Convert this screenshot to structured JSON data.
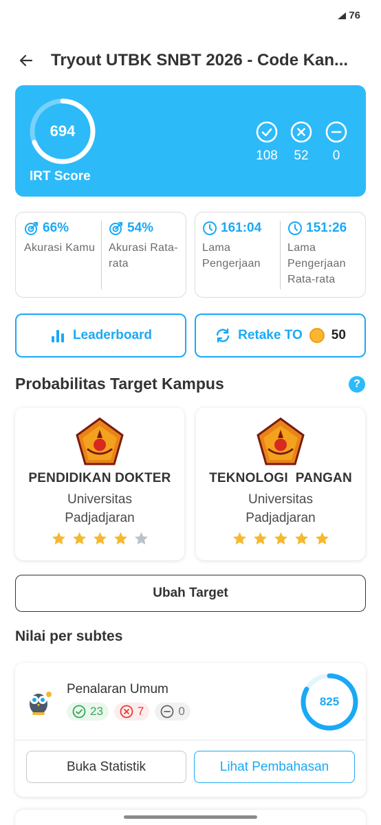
{
  "status": {
    "battery": "76"
  },
  "header": {
    "title": "Tryout UTBK SNBT 2026 - Code Kan..."
  },
  "score": {
    "value": "694",
    "label": "IRT Score",
    "progress": 0.69,
    "correct": "108",
    "wrong": "52",
    "empty": "0"
  },
  "metrics": {
    "accuracy_you": {
      "value": "66%",
      "label": "Akurasi Kamu"
    },
    "accuracy_avg": {
      "value": "54%",
      "label": "Akurasi Rata-rata"
    },
    "time_you": {
      "value": "161:04",
      "label": "Lama Pengerjaan"
    },
    "time_avg": {
      "value": "151:26",
      "label": "Lama Pengerjaan Rata-rata"
    }
  },
  "actions": {
    "leaderboard": "Leaderboard",
    "retake": "Retake TO",
    "retake_cost": "50"
  },
  "targets": {
    "title": "Probabilitas Target Kampus",
    "help": "?",
    "items": [
      {
        "major": "PENDIDIKAN DOKTER",
        "university": "Universitas Padjadjaran",
        "rating": 4,
        "max_rating": 5
      },
      {
        "major": "TEKNOLOGI  PANGAN",
        "university": "Universitas Padjadjaran",
        "rating": 5,
        "max_rating": 5
      }
    ],
    "change_button": "Ubah Target"
  },
  "subtests": {
    "title": "Nilai per subtes",
    "items": [
      {
        "name": "Penalaran Umum",
        "correct": "23",
        "wrong": "7",
        "empty": "0",
        "score": "825",
        "progress": 0.83,
        "stat_button": "Buka Statistik",
        "discussion_button": "Lihat Pembahasan"
      }
    ]
  },
  "colors": {
    "primary": "#2dbaf9",
    "accent": "#1aa9f5",
    "star": "#f5b82e",
    "star_empty": "#b9c2c9"
  }
}
